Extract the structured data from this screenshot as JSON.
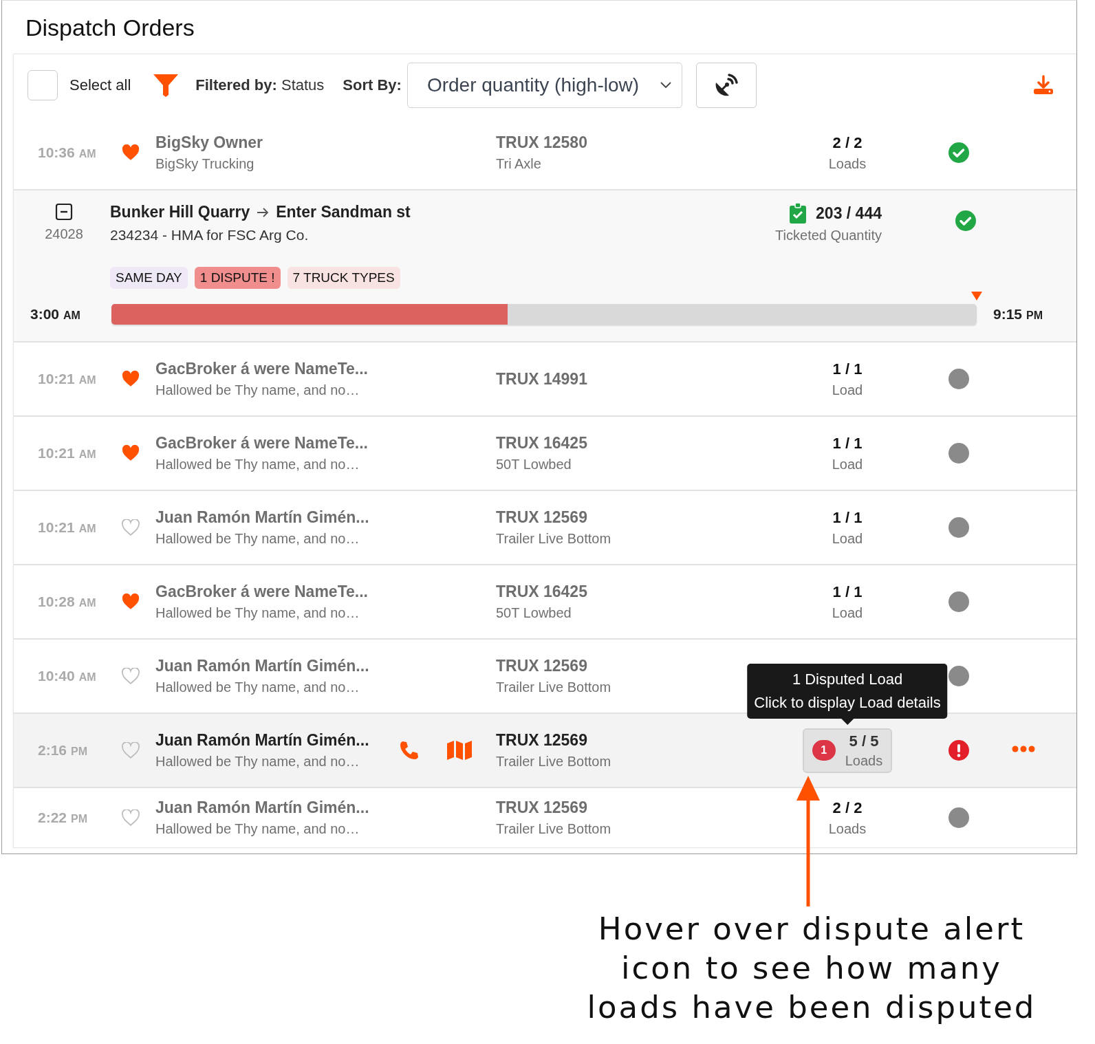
{
  "title": "Dispatch Orders",
  "toolbar": {
    "select_all": {
      "label": "Select all",
      "checked": false
    },
    "filter": {
      "label": "Filtered by:",
      "value": "Status"
    },
    "sort": {
      "label": "Sort By:",
      "value": "Order quantity (high-low)"
    }
  },
  "rows": [
    {
      "kind": "driver",
      "time": "10:36",
      "period": "AM",
      "favorite": true,
      "hovered": false,
      "name": "BigSky Owner",
      "company": "BigSky Trucking",
      "truck": "TRUX 12580",
      "truck_type": "Tri Axle",
      "loads": "2 / 2",
      "loads_label": "Loads",
      "status": {
        "kind": "complete"
      }
    },
    {
      "kind": "order",
      "expanded": true,
      "id": "24028",
      "origin": "Bunker Hill Quarry",
      "destination": "Enter Sandman st",
      "description": "234234 - HMA for FSC Arg Co.",
      "tags": [
        {
          "label": "SAME DAY",
          "color": "#efe8f6"
        },
        {
          "label": "1 DISPUTE !",
          "color": "#f08d8d"
        },
        {
          "label": "7 TRUCK TYPES",
          "color": "#f9e2e2"
        }
      ],
      "quantity": "203 / 444",
      "quantity_label": "Ticketed Quantity",
      "status": {
        "kind": "complete"
      },
      "timeline": {
        "start": "3:00",
        "start_period": "AM",
        "end": "9:15",
        "end_period": "PM",
        "level": 0.458
      }
    },
    {
      "kind": "driver",
      "time": "10:21",
      "period": "AM",
      "favorite": true,
      "hovered": false,
      "name": "GacBroker á were NameTe...",
      "company": "Hallowed be Thy name, and no…",
      "truck": "TRUX 14991",
      "loads": "1 / 1",
      "loads_label": "Load",
      "status": {
        "kind": "pending"
      }
    },
    {
      "kind": "driver",
      "time": "10:21",
      "period": "AM",
      "favorite": true,
      "hovered": false,
      "name": "GacBroker á were NameTe...",
      "company": "Hallowed be Thy name, and no…",
      "truck": "TRUX 16425",
      "truck_type": "50T Lowbed",
      "loads": "1 / 1",
      "loads_label": "Load",
      "status": {
        "kind": "pending"
      }
    },
    {
      "kind": "driver",
      "time": "10:21",
      "period": "AM",
      "favorite": false,
      "hovered": false,
      "name": "Juan Ramón Martín Gimén...",
      "company": "Hallowed be Thy name, and no…",
      "truck": "TRUX 12569",
      "truck_type": "Trailer Live Bottom",
      "loads": "1 / 1",
      "loads_label": "Load",
      "status": {
        "kind": "pending"
      }
    },
    {
      "kind": "driver",
      "time": "10:28",
      "period": "AM",
      "favorite": true,
      "hovered": false,
      "name": "GacBroker á were NameTe...",
      "company": "Hallowed be Thy name, and no…",
      "truck": "TRUX 16425",
      "truck_type": "50T Lowbed",
      "loads": "1 / 1",
      "loads_label": "Load",
      "status": {
        "kind": "pending"
      }
    },
    {
      "kind": "driver",
      "time": "10:40",
      "period": "AM",
      "favorite": false,
      "hovered": false,
      "name": "Juan Ramón Martín Gimén...",
      "company": "Hallowed be Thy name, and no…",
      "truck": "TRUX 12569",
      "truck_type": "Trailer Live Bottom",
      "status": {
        "kind": "pending"
      }
    },
    {
      "kind": "driver",
      "time": "2:16",
      "period": "PM",
      "favorite": false,
      "hovered": true,
      "name": "Juan Ramón Martín Gimén...",
      "company": "Hallowed be Thy name, and no…",
      "truck": "TRUX 12569",
      "truck_type": "Trailer Live Bottom",
      "loads": "5 / 5",
      "loads_label": "Loads",
      "dispute_count": "1",
      "tooltip": "1 Disputed Load\nClick to display Load details",
      "status": {
        "kind": "alert"
      }
    },
    {
      "kind": "driver",
      "time": "2:22",
      "period": "PM",
      "favorite": false,
      "hovered": false,
      "name": "Juan Ramón Martín Gimén...",
      "company": "Hallowed be Thy name, and no…",
      "truck": "TRUX 12569",
      "truck_type": "Trailer Live Bottom",
      "loads": "2 / 2",
      "loads_label": "Loads",
      "status": {
        "kind": "pending"
      }
    }
  ],
  "annotation": "Hover over dispute alert\nicon to see how many\nloads have been disputed"
}
